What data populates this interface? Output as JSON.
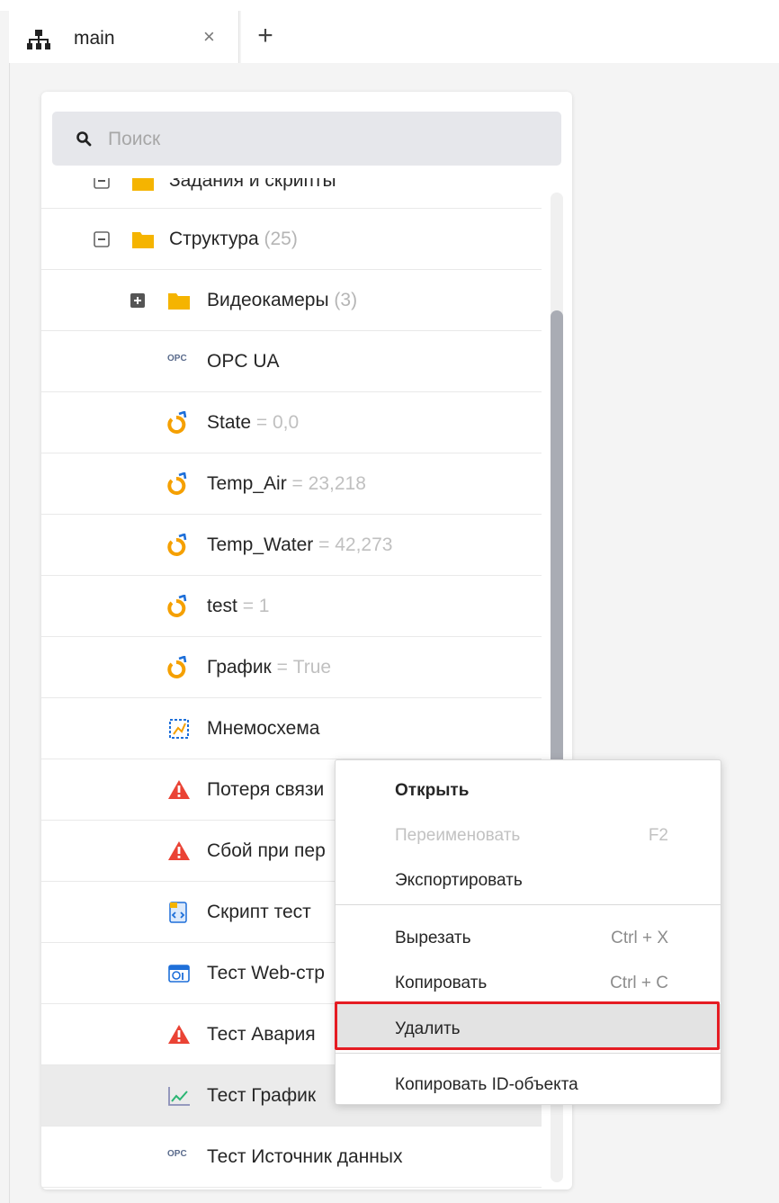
{
  "tab": {
    "label": "main",
    "close_glyph": "×",
    "add_glyph": "+",
    "icon": "hierarchy-icon"
  },
  "search": {
    "placeholder": "Поиск",
    "value": "",
    "icon": "search-icon"
  },
  "tree": {
    "cut_row_label": "Задания и скрипты",
    "rows": [
      {
        "label": "Структура",
        "count": "(25)",
        "icon": "folder-icon",
        "expander": "minus"
      },
      {
        "label": "Видеокамеры",
        "count": "(3)",
        "icon": "folder-icon",
        "expander": "plus"
      },
      {
        "label": "OPC UA",
        "icon": "opc-icon"
      },
      {
        "label": "State",
        "value": "= 0,0",
        "icon": "tag-icon"
      },
      {
        "label": "Temp_Air",
        "value": "= 23,218",
        "icon": "tag-icon"
      },
      {
        "label": "Temp_Water",
        "value": "= 42,273",
        "icon": "tag-icon"
      },
      {
        "label": "test",
        "value": "= 1",
        "icon": "tag-icon"
      },
      {
        "label": "График",
        "value": "= True",
        "icon": "tag-icon"
      },
      {
        "label": "Мнемосхема",
        "icon": "mnemonic-icon"
      },
      {
        "label": "Потеря связи",
        "icon": "alarm-icon"
      },
      {
        "label": "Сбой при пер",
        "icon": "alarm-icon"
      },
      {
        "label": "Скрипт тест",
        "icon": "script-icon"
      },
      {
        "label": "Тест Web-стр",
        "icon": "webpage-icon"
      },
      {
        "label": "Тест Авария",
        "icon": "alarm-icon"
      },
      {
        "label": "Тест График",
        "icon": "chart-icon",
        "selected": true
      },
      {
        "label": "Тест Источник данных",
        "icon": "opc-icon"
      }
    ],
    "opc_badge": "OPC"
  },
  "context_menu": {
    "open": "Открыть",
    "rename": "Переименовать",
    "rename_key": "F2",
    "export": "Экспортировать",
    "cut": "Вырезать",
    "cut_key": "Ctrl + X",
    "copy": "Копировать",
    "copy_key": "Ctrl + C",
    "delete": "Удалить",
    "copy_id": "Копировать ID-объекта"
  },
  "colors": {
    "folder": "#f5b400",
    "alarm": "#ea4335",
    "tag_orange": "#f5a000",
    "tag_blue": "#1e6fd9",
    "highlight": "#e51c23",
    "scroll_thumb": "#a9acb4"
  }
}
